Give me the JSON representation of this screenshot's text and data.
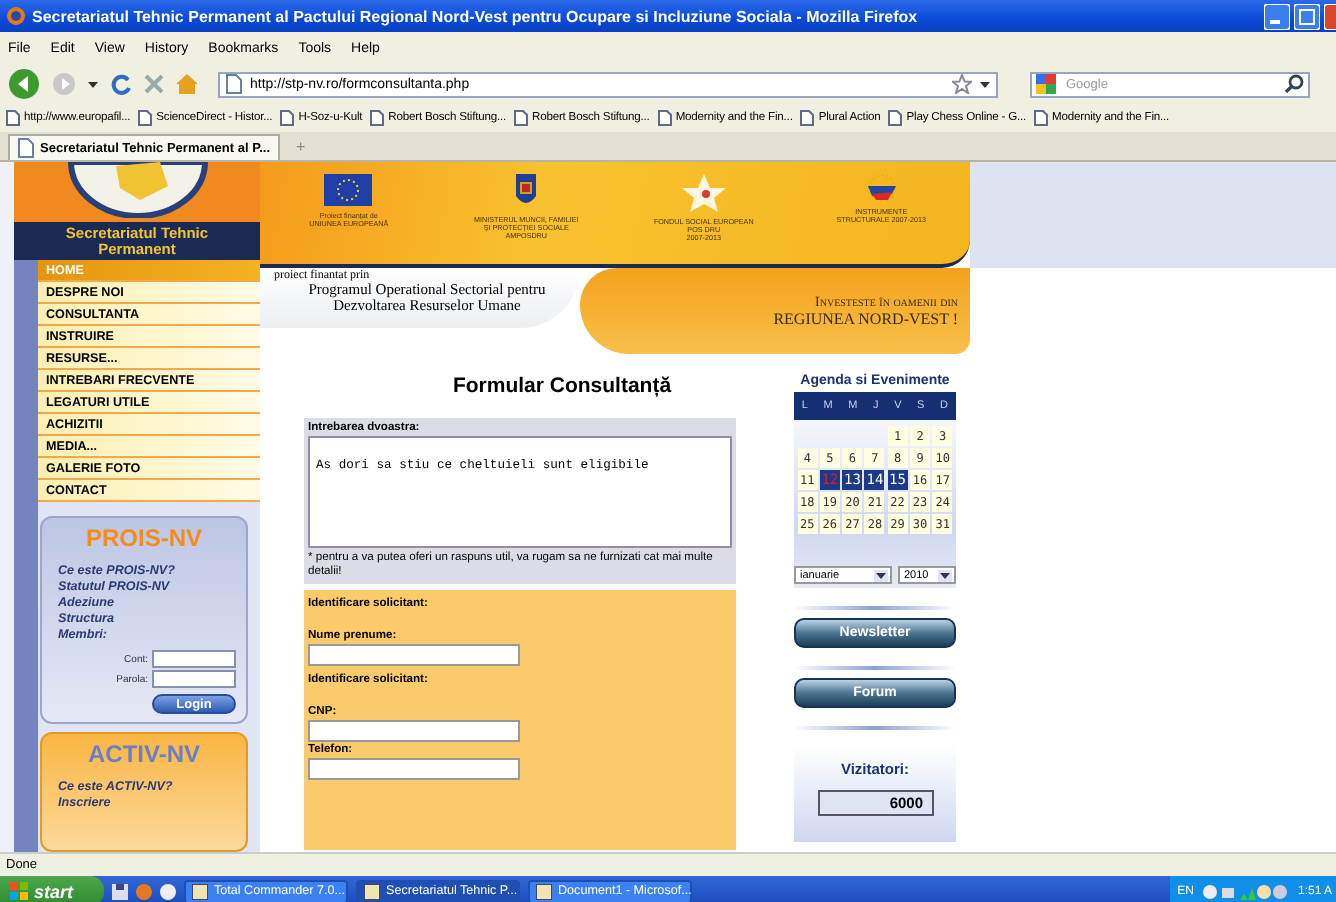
{
  "window": {
    "title": "Secretariatul Tehnic Permanent al Pactului Regional Nord-Vest pentru Ocupare si Incluziune Sociala - Mozilla Firefox"
  },
  "menu": [
    "File",
    "Edit",
    "View",
    "History",
    "Bookmarks",
    "Tools",
    "Help"
  ],
  "address": {
    "value": "http://stp-nv.ro/formconsultanta.php"
  },
  "search": {
    "placeholder": "Google"
  },
  "bookmarks": [
    "http://www.europafil...",
    "ScienceDirect - Histor...",
    "H-Soz-u-Kult",
    "Robert Bosch Stiftung...",
    "Robert Bosch Stiftung...",
    "Modernity and the Fin...",
    "Plural Action",
    "Play Chess Online - G...",
    "Modernity and the Fin..."
  ],
  "tabs": [
    {
      "label": "Secretariatul Tehnic Permanent al P...",
      "selected": true
    }
  ],
  "new_tab": "+",
  "site": {
    "logo_title": "Secretariatul Tehnic Permanent",
    "nav": [
      {
        "label": "HOME",
        "selected": true
      },
      {
        "label": "DESPRE NOI",
        "selected": false
      },
      {
        "label": "CONSULTANTA",
        "selected": false
      },
      {
        "label": "INSTRUIRE",
        "selected": false
      },
      {
        "label": "RESURSE...",
        "selected": false
      },
      {
        "label": "INTREBARI FRECVENTE",
        "selected": false
      },
      {
        "label": "LEGATURI UTILE",
        "selected": false
      },
      {
        "label": "ACHIZITII",
        "selected": false
      },
      {
        "label": "MEDIA...",
        "selected": false
      },
      {
        "label": "GALERIE FOTO",
        "selected": false
      },
      {
        "label": "CONTACT",
        "selected": false
      }
    ],
    "sponsors": [
      {
        "lines": [
          "Proiect finanțat de",
          "UNIUNEA EUROPEANĂ"
        ]
      },
      {
        "lines": [
          "MINISTERUL MUNCII, FAMILIEI",
          "ȘI PROTECȚIEI SOCIALE",
          "AMPOSDRU"
        ]
      },
      {
        "lines": [
          "FONDUL SOCIAL EUROPEAN",
          "POS DRU",
          "2007-2013"
        ]
      },
      {
        "lines": [
          "INSTRUMENTE",
          "STRUCTURALE 2007-2013"
        ]
      }
    ],
    "funding": {
      "intro": "proiect finantat prin",
      "program": [
        "Programul Operational Sectorial pentru",
        "Dezvoltarea Resurselor Umane"
      ]
    },
    "slogan": {
      "line1": "Investeste în oamenii din",
      "line2": "REGIUNEA NORD-VEST !"
    },
    "prois": {
      "title": "PROIS-NV",
      "links": [
        "Ce este PROIS-NV?",
        "Statutul PROIS-NV",
        "Adeziune",
        "Structura",
        "Membri:"
      ],
      "fields": [
        "Cont:",
        "Parola:"
      ],
      "button": "Login"
    },
    "activ": {
      "title": "ACTIV-NV",
      "links": [
        "Ce este ACTIV-NV?",
        "Inscriere"
      ]
    },
    "form": {
      "title": "Formular Consultanță",
      "question_label": "Intrebarea dvoastra:",
      "question_value": "As dori sa stiu ce cheltuieli sunt eligibile",
      "note": "* pentru a va putea oferi un raspuns util, va rugam sa ne furnizati cat mai multe detalii!",
      "fields": [
        {
          "kind": "heading",
          "label": "Identificare solicitant:"
        },
        {
          "kind": "field",
          "label": "Nume prenume:"
        },
        {
          "kind": "heading",
          "label": "Identificare solicitant:"
        },
        {
          "kind": "field",
          "label": "CNP:"
        },
        {
          "kind": "field",
          "label": "Telefon:"
        }
      ]
    },
    "agenda": {
      "title": "Agenda si Evenimente",
      "weekdays": [
        "L",
        "M",
        "M",
        "J",
        "V",
        "S",
        "D"
      ],
      "weeks": [
        [
          {
            "kind": "blank"
          },
          {
            "kind": "blank"
          },
          {
            "kind": "blank"
          },
          {
            "kind": "blank"
          },
          {
            "kind": "day",
            "label": "1"
          },
          {
            "kind": "day",
            "label": "2"
          },
          {
            "kind": "day",
            "label": "3"
          }
        ],
        [
          {
            "kind": "day",
            "label": "4"
          },
          {
            "kind": "day",
            "label": "5"
          },
          {
            "kind": "day",
            "label": "6"
          },
          {
            "kind": "day",
            "label": "7"
          },
          {
            "kind": "day",
            "label": "8"
          },
          {
            "kind": "day",
            "label": "9"
          },
          {
            "kind": "day",
            "label": "10"
          }
        ],
        [
          {
            "kind": "day",
            "label": "11"
          },
          {
            "kind": "today",
            "label": "12"
          },
          {
            "kind": "event",
            "label": "13"
          },
          {
            "kind": "event",
            "label": "14"
          },
          {
            "kind": "event",
            "label": "15"
          },
          {
            "kind": "day",
            "label": "16"
          },
          {
            "kind": "day",
            "label": "17"
          }
        ],
        [
          {
            "kind": "day",
            "label": "18"
          },
          {
            "kind": "day",
            "label": "19"
          },
          {
            "kind": "day",
            "label": "20"
          },
          {
            "kind": "day",
            "label": "21"
          },
          {
            "kind": "day",
            "label": "22"
          },
          {
            "kind": "day",
            "label": "23"
          },
          {
            "kind": "day",
            "label": "24"
          }
        ],
        [
          {
            "kind": "day",
            "label": "25"
          },
          {
            "kind": "day",
            "label": "26"
          },
          {
            "kind": "day",
            "label": "27"
          },
          {
            "kind": "day",
            "label": "28"
          },
          {
            "kind": "day",
            "label": "29"
          },
          {
            "kind": "day",
            "label": "30"
          },
          {
            "kind": "day",
            "label": "31"
          }
        ]
      ],
      "month": "ianuarie",
      "year": "2010"
    },
    "buttons": [
      "Newsletter",
      "Forum"
    ],
    "visitors": {
      "label": "Vizitatori:",
      "count": "6000"
    }
  },
  "status_bar": "Done",
  "taskbar": {
    "start": "start",
    "tasks": [
      {
        "label": "Total Commander 7.0...",
        "selected": false
      },
      {
        "label": "Secretariatul Tehnic P...",
        "selected": true
      },
      {
        "label": "Document1 - Microsof...",
        "selected": false
      }
    ],
    "language": "EN",
    "clock": "1:51 A"
  }
}
